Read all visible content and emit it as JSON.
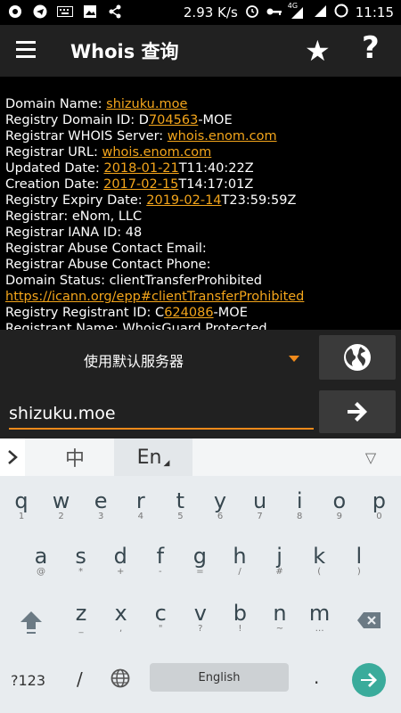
{
  "status_bar": {
    "network_speed": "2.93 K/s",
    "signal_label": "4G",
    "time": "11:15"
  },
  "app_bar": {
    "title": "Whois 查询",
    "help_label": "?"
  },
  "whois": {
    "lines": [
      {
        "prefix": "Domain Name: ",
        "link": "shizuku.moe",
        "suffix": ""
      },
      {
        "prefix": "Registry Domain ID: D",
        "link": "704563",
        "suffix": "-MOE"
      },
      {
        "prefix": "Registrar WHOIS Server: ",
        "link": "whois.enom.com",
        "suffix": ""
      },
      {
        "prefix": "Registrar URL: ",
        "link": "whois.enom.com",
        "suffix": ""
      },
      {
        "prefix": "Updated Date: ",
        "link": "2018-01-21",
        "suffix": "T11:40:22Z"
      },
      {
        "prefix": "Creation Date: ",
        "link": "2017-02-15",
        "suffix": "T14:17:01Z"
      },
      {
        "prefix": "Registry Expiry Date: ",
        "link": "2019-02-14",
        "suffix": "T23:59:59Z"
      },
      {
        "prefix": "Registrar: eNom, LLC",
        "link": "",
        "suffix": ""
      },
      {
        "prefix": "Registrar IANA ID: 48",
        "link": "",
        "suffix": ""
      },
      {
        "prefix": "Registrar Abuse Contact Email:",
        "link": "",
        "suffix": ""
      },
      {
        "prefix": "Registrar Abuse Contact Phone:",
        "link": "",
        "suffix": ""
      },
      {
        "prefix": "Domain Status: clientTransferProhibited",
        "link": "",
        "suffix": ""
      },
      {
        "prefix": "",
        "link": "https://icann.org/epp#clientTransferProhibited",
        "suffix": ""
      },
      {
        "prefix": "Registry Registrant ID: C",
        "link": "624086",
        "suffix": "-MOE"
      },
      {
        "prefix": "Registrant Name: WhoisGuard Protected",
        "link": "",
        "suffix": ""
      }
    ]
  },
  "server": {
    "selected": "使用默认服务器"
  },
  "query": {
    "value": "shizuku.moe"
  },
  "keyboard": {
    "mode_chinese": "中",
    "mode_english": "En",
    "row1": [
      [
        "q",
        "1"
      ],
      [
        "w",
        "2"
      ],
      [
        "e",
        "3"
      ],
      [
        "r",
        "4"
      ],
      [
        "t",
        "5"
      ],
      [
        "y",
        "6"
      ],
      [
        "u",
        "7"
      ],
      [
        "i",
        "8"
      ],
      [
        "o",
        "9"
      ],
      [
        "p",
        "0"
      ]
    ],
    "row2": [
      [
        "a",
        "@"
      ],
      [
        "s",
        "*"
      ],
      [
        "d",
        "+"
      ],
      [
        "f",
        "-"
      ],
      [
        "g",
        "="
      ],
      [
        "h",
        "/"
      ],
      [
        "j",
        "#"
      ],
      [
        "k",
        "("
      ],
      [
        "l",
        ")"
      ]
    ],
    "row3": [
      [
        "z",
        "_"
      ],
      [
        "x",
        ","
      ],
      [
        "c",
        "\""
      ],
      [
        "v",
        "?"
      ],
      [
        "b",
        "!"
      ],
      [
        "n",
        "~"
      ],
      [
        "m",
        "…"
      ]
    ],
    "symbols_label": "?123",
    "slash_label": "/",
    "space_label": "English",
    "period_label": "."
  },
  "colors": {
    "accent": "#f08a1b",
    "link": "#f3a51b",
    "appbar": "#212121",
    "enter": "#3aab9b"
  }
}
